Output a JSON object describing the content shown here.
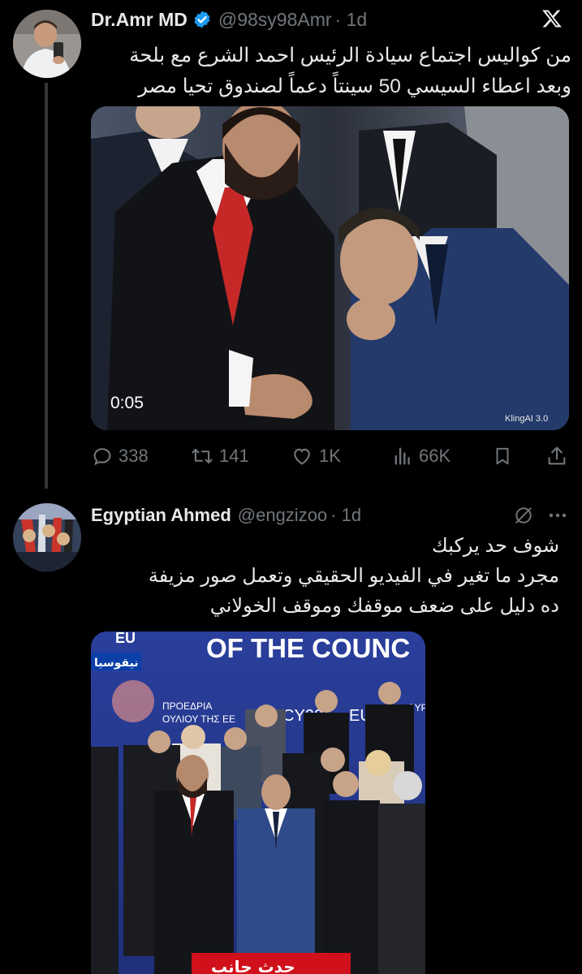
{
  "tweet1": {
    "author_name": "Dr.Amr MD",
    "handle": "@98sy98Amr",
    "time": "· 1d",
    "lines": [
      "من كواليس اجتماع سيادة الرئيس احمد الشرع مع بلحة",
      "وبعد اعطاء السيسي 50 سينتاً دعماً لصندوق تحيا مصر"
    ],
    "video_duration": "0:05",
    "watermark": "KlingAI 3.0",
    "stats": {
      "replies": "338",
      "reposts": "141",
      "likes": "1K",
      "views": "66K"
    }
  },
  "tweet2": {
    "author_name": "Egyptian Ahmed",
    "handle": "@engzizoo",
    "time": "· 1d",
    "lines": [
      "شوف حد يركبك",
      "مجرد ما تغير في الفيديو الحقيقي وتعمل صور مزيفة",
      "ده دليل على ضعف موقفك وموقف الخولاني"
    ],
    "image_banner": "OF THE COUNC",
    "image_banner_prefix": "EU",
    "city_tag": "نيقوسيا",
    "greek_text_1": "ΠΡΟΕΔΡΙΑ",
    "greek_text_2": "ΟΥΛΙΟΥ ΤΗΣ ΕΕ",
    "cy_text": "CY20",
    "cy_text2": "EU",
    "cy_text3": "CYP",
    "breaking_text": "حدث جانب"
  },
  "colors": {
    "background": "#000000",
    "text": "#e7e9ea",
    "muted": "#71767b",
    "verified": "#1d9bf0",
    "banner_blue": "#2a3f9c",
    "breaking_red": "#d0101a"
  },
  "icons": [
    "x-logo-icon",
    "verified-badge-icon",
    "reply-icon",
    "repost-icon",
    "like-icon",
    "views-icon",
    "bookmark-icon",
    "share-icon",
    "grok-icon",
    "more-icon"
  ]
}
